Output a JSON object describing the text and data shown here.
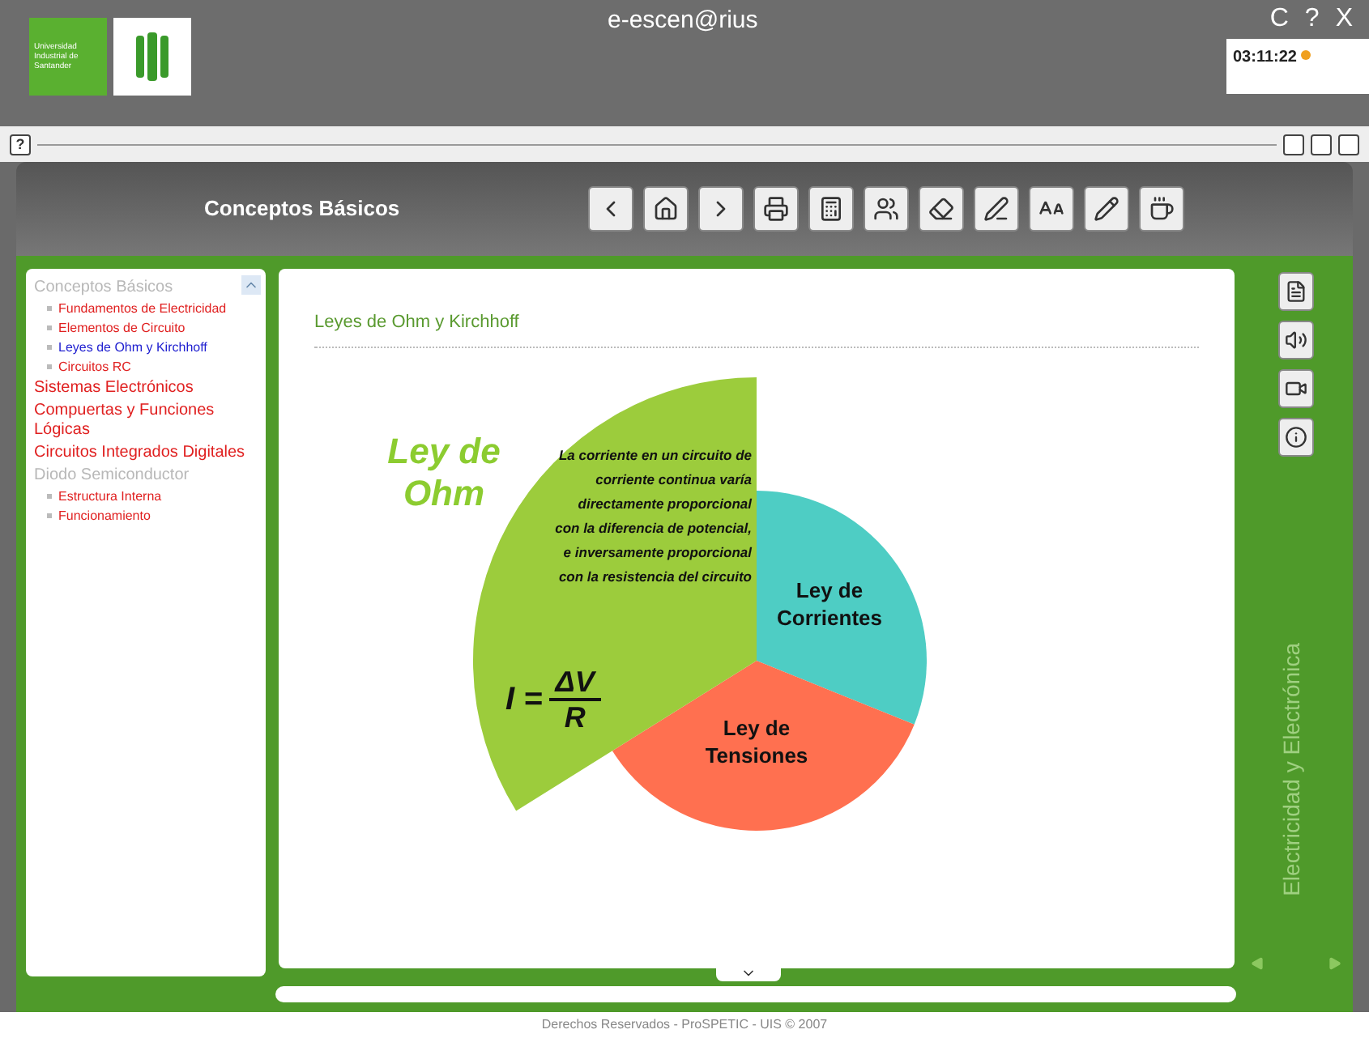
{
  "header": {
    "logo_text": "Universidad Industrial de Santander",
    "app_title": "e-escen@rius",
    "window_controls": [
      "C",
      "?",
      "X"
    ],
    "clock": "03:11:22"
  },
  "subwindow": {
    "help": "?"
  },
  "toolbar": {
    "title": "Conceptos Básicos"
  },
  "sidebar": {
    "items": [
      {
        "label": "Conceptos Básicos",
        "selected": false,
        "children": [
          {
            "label": "Fundamentos de Electricidad",
            "selected": false
          },
          {
            "label": "Elementos de Circuito",
            "selected": false
          },
          {
            "label": "Leyes de Ohm y Kirchhoff",
            "selected": true
          },
          {
            "label": "Circuitos RC",
            "selected": false
          }
        ]
      },
      {
        "label": "Sistemas Electrónicos",
        "selected": false
      },
      {
        "label": "Compuertas y Funciones Lógicas",
        "selected": false
      },
      {
        "label": "Circuitos Integrados Digitales",
        "selected": false
      },
      {
        "label": "Diodo Semiconductor",
        "selected": false,
        "children": [
          {
            "label": "Estructura Interna",
            "selected": false
          },
          {
            "label": "Funcionamiento",
            "selected": false
          }
        ]
      }
    ]
  },
  "content": {
    "heading": "Leyes de Ohm y Kirchhoff",
    "diagram": {
      "title": "Ley de Ohm",
      "description": "La corriente en un circuito de corriente continua varía directamente proporcional con la diferencia de potencial, e inversamente proporcional con la resistencia del circuito",
      "formula_lhs": "I =",
      "formula_num": "ΔV",
      "formula_den": "R",
      "sectors": [
        {
          "label": "Ley de Corrientes",
          "color": "#4ecdc4"
        },
        {
          "label": "Ley de Tensiones",
          "color": "#ff7050"
        }
      ]
    }
  },
  "side_label": "Electricidad y Electrónica",
  "footer": "Derechos Reservados - ProSPETIC - UIS © 2007"
}
